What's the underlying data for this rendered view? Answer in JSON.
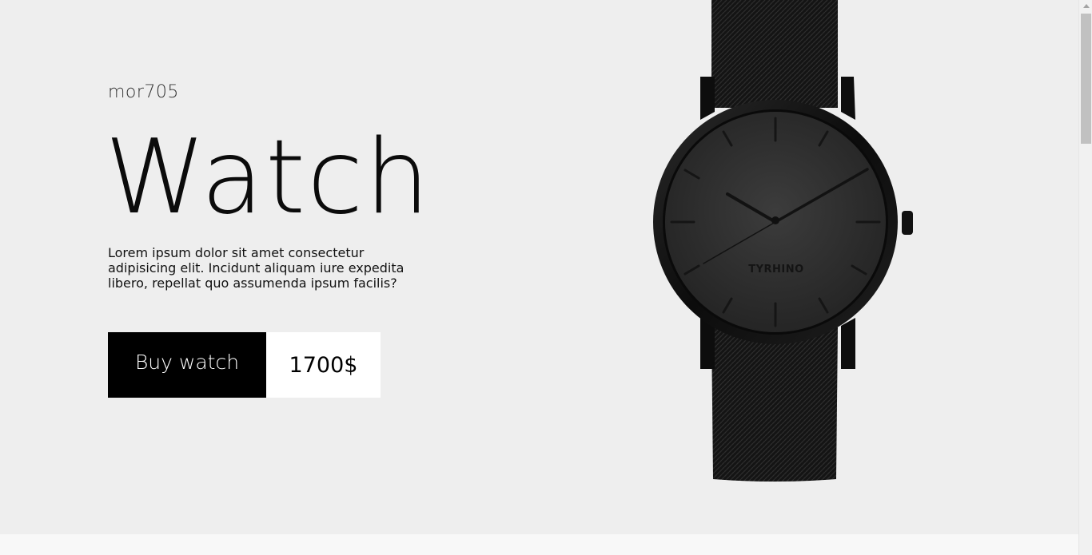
{
  "hero": {
    "brand": "mor705",
    "headline": "Watch",
    "description": "Lorem ipsum dolor sit amet consectetur adipisicing elit. Incidunt aliquam iure expedita libero, repellat quo assumenda ipsum facilis?",
    "buy_label": "Buy watch",
    "price": "1700$"
  },
  "watch": {
    "dial_brand": "TYRHINO"
  },
  "colors": {
    "background": "#eeeeee",
    "button": "#000000",
    "price_bg": "#ffffff",
    "watch_dark": "#1a1a1a"
  }
}
